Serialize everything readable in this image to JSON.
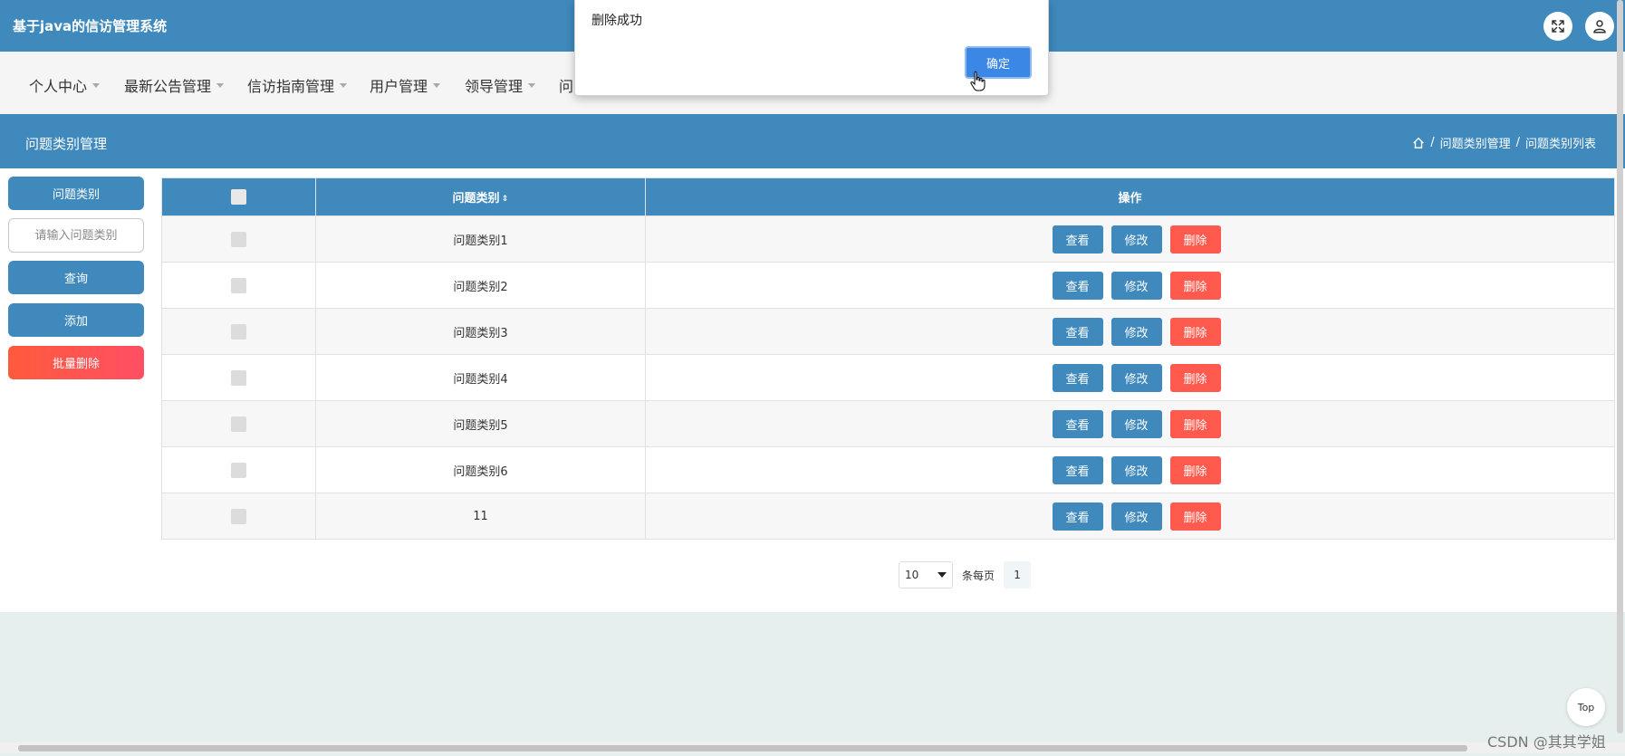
{
  "app": {
    "title": "基于java的信访管理系统"
  },
  "header_icons": [
    "fullscreen-icon",
    "user-icon"
  ],
  "nav": {
    "items": [
      {
        "label": "个人中心"
      },
      {
        "label": "最新公告管理"
      },
      {
        "label": "信访指南管理"
      },
      {
        "label": "用户管理"
      },
      {
        "label": "领导管理"
      },
      {
        "label": "问"
      }
    ]
  },
  "page": {
    "title": "问题类别管理",
    "breadcrumb": {
      "sep": "/",
      "items": [
        "问题类别管理",
        "问题类别列表"
      ]
    }
  },
  "sidebar": {
    "filter_label": "问题类别",
    "search_placeholder": "请输入问题类别",
    "search_button": "查询",
    "add_button": "添加",
    "batch_delete_button": "批量删除"
  },
  "table": {
    "columns": {
      "category": "问题类别",
      "operations": "操作"
    },
    "rows": [
      {
        "category": "问题类别1"
      },
      {
        "category": "问题类别2"
      },
      {
        "category": "问题类别3"
      },
      {
        "category": "问题类别4"
      },
      {
        "category": "问题类别5"
      },
      {
        "category": "问题类别6"
      },
      {
        "category": "11"
      }
    ],
    "actions": {
      "view": "查看",
      "edit": "修改",
      "delete": "删除"
    }
  },
  "pagination": {
    "page_size": "10",
    "per_page_label": "条每页",
    "current_page": "1"
  },
  "back_to_top": "Top",
  "watermark": "CSDN @其其学姐",
  "dialog": {
    "message": "删除成功",
    "ok_button": "确定"
  },
  "colors": {
    "primary": "#3f89bd",
    "danger": "#ff5a4d",
    "dialog_button": "#3b87e6"
  }
}
